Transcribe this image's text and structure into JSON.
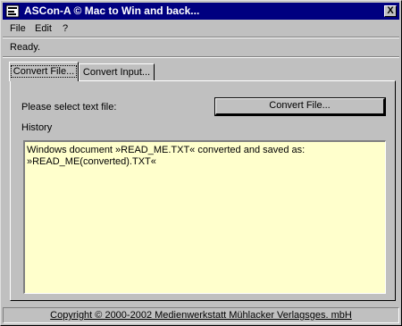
{
  "window": {
    "title": "ASCon-A © Mac to Win and back...",
    "close_label": "X"
  },
  "menu": {
    "items": [
      "File",
      "Edit",
      "?"
    ]
  },
  "status": "Ready.",
  "tabs": [
    {
      "label": "Convert File...",
      "active": true
    },
    {
      "label": "Convert Input...",
      "active": false
    }
  ],
  "panel": {
    "select_label": "Please select text file:",
    "convert_button": "Convert File...",
    "history_label": "History",
    "history_lines": [
      "Windows document »READ_ME.TXT« converted and saved as:",
      "»READ_ME(converted).TXT«"
    ]
  },
  "footer": "Copyright © 2000-2002 Medienwerkstatt Mühlacker Verlagsges. mbH",
  "colors": {
    "titlebar": "#000080",
    "history_bg": "#ffffcc",
    "window_bg": "#c0c0c0"
  }
}
